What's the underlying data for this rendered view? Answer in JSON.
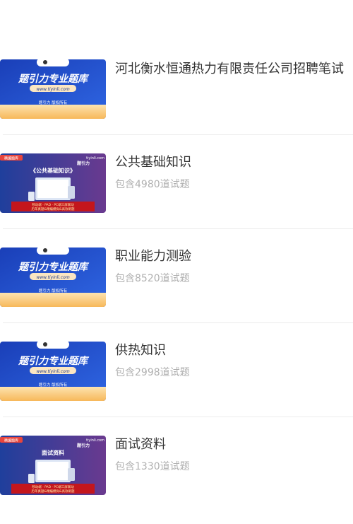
{
  "items": [
    {
      "title": "河北衡水恒通热力有限责任公司招聘笔试",
      "subtitle": "",
      "thumb": {
        "variant": "tiyinli",
        "brand": "题引力专业题库",
        "url": "www.tiyinli.com",
        "footer": "题引力 版权所有"
      }
    },
    {
      "title": "公共基础知识",
      "subtitle": "包含4980道试题",
      "thumb": {
        "variant": "course",
        "tag": "精编题库",
        "site": "tiyinli.com",
        "logo": "题引力",
        "heading": "《公共基础知识》",
        "banner1": "移动端 · PAD · PC端三屏联动",
        "banner2": "历年真题&精编模拟&高效刷题"
      }
    },
    {
      "title": "职业能力测验",
      "subtitle": "包含8520道试题",
      "thumb": {
        "variant": "tiyinli",
        "brand": "题引力专业题库",
        "url": "www.tiyinli.com",
        "footer": "题引力 版权所有"
      }
    },
    {
      "title": "供热知识",
      "subtitle": "包含2998道试题",
      "thumb": {
        "variant": "tiyinli",
        "brand": "题引力专业题库",
        "url": "www.tiyinli.com",
        "footer": "题引力 版权所有"
      }
    },
    {
      "title": "面试资料",
      "subtitle": "包含1330道试题",
      "thumb": {
        "variant": "course",
        "tag": "精编题库",
        "site": "tiyinli.com",
        "logo": "题引力",
        "heading": "面试资料",
        "banner1": "移动端 · PAD · PC端三屏联动",
        "banner2": "历年真题&精编模拟&高效刷题"
      }
    }
  ],
  "colors": {
    "brand_blue": "#1e4fd0",
    "brand_orange": "#f59a23",
    "course_purple": "#6a3a8f",
    "banner_red": "#c4161c"
  }
}
